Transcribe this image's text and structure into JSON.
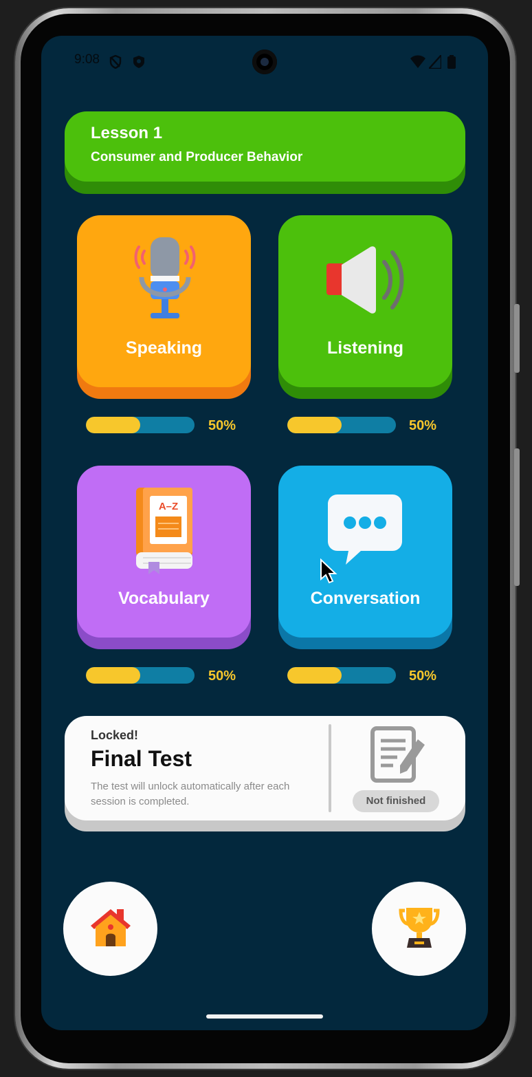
{
  "status_bar": {
    "time": "9:08"
  },
  "lesson": {
    "title": "Lesson 1",
    "subtitle": "Consumer and Producer Behavior"
  },
  "tiles": [
    {
      "label": "Speaking",
      "progress_label": "50%",
      "progress": 0.5,
      "color": "#ffa70f",
      "shade": "#f07a10",
      "icon": "microphone-icon"
    },
    {
      "label": "Listening",
      "progress_label": "50%",
      "progress": 0.5,
      "color": "#4cc00c",
      "shade": "#2f8d07",
      "icon": "speaker-icon"
    },
    {
      "label": "Vocabulary",
      "progress_label": "50%",
      "progress": 0.5,
      "color": "#c06df5",
      "shade": "#8b4cc8",
      "icon": "dictionary-book-icon"
    },
    {
      "label": "Conversation",
      "progress_label": "50%",
      "progress": 0.5,
      "color": "#14aee6",
      "shade": "#0b77a8",
      "icon": "chat-bubble-icon"
    }
  ],
  "final_test": {
    "status": "Locked!",
    "title": "Final Test",
    "description": "The test will unlock automatically after each session is completed.",
    "badge": "Not finished",
    "icon": "test-document-icon"
  },
  "nav": {
    "home_icon": "home-icon",
    "trophy_icon": "trophy-icon"
  }
}
